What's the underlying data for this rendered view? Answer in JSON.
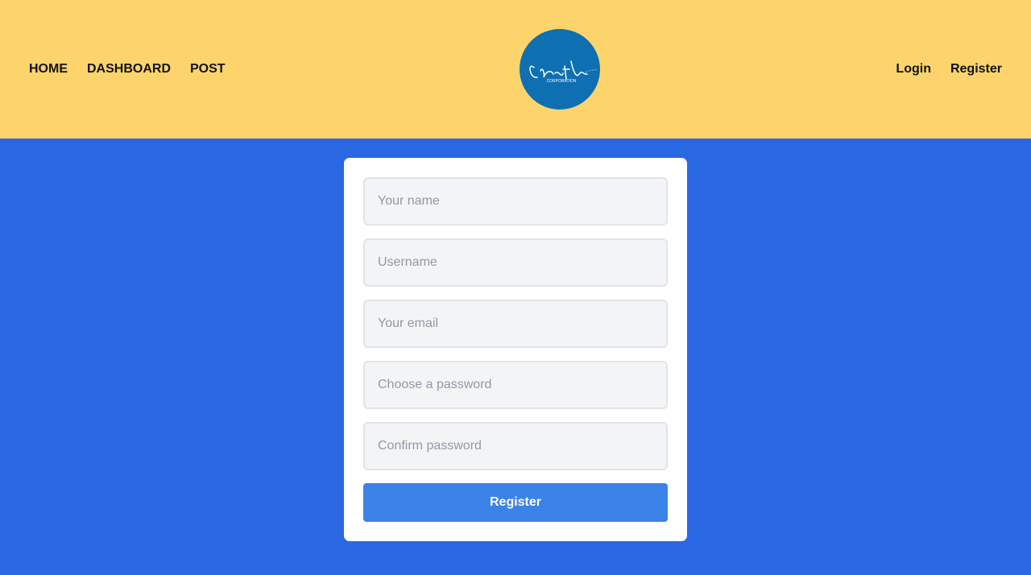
{
  "nav": {
    "left": [
      "HOME",
      "DASHBOARD",
      "POST"
    ],
    "right": [
      "Login",
      "Register"
    ]
  },
  "logo": {
    "icon": "create-corporation-logo",
    "text": "Create",
    "subtext": "CORPORATION"
  },
  "form": {
    "name_placeholder": "Your name",
    "username_placeholder": "Username",
    "email_placeholder": "Your email",
    "password_placeholder": "Choose a password",
    "confirm_placeholder": "Confirm password",
    "submit_label": "Register"
  },
  "colors": {
    "header_bg": "#fdd46b",
    "page_bg": "#2a67e3",
    "button_bg": "#3b82e9",
    "logo_bg": "#0e6fb3"
  }
}
